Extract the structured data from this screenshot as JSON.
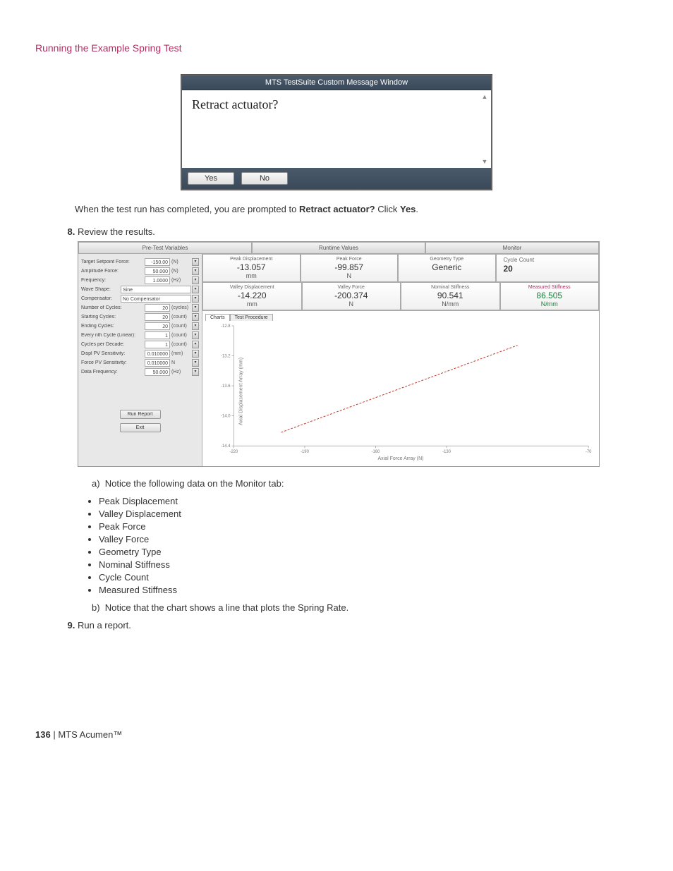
{
  "section_title": "Running the Example Spring Test",
  "dialog": {
    "title": "MTS TestSuite Custom Message Window",
    "message": "Retract actuator?",
    "yes": "Yes",
    "no": "No"
  },
  "intro_line_pre": "When the test run has completed, you are prompted to ",
  "intro_line_bold1": "Retract actuator?",
  "intro_line_mid": " Click ",
  "intro_line_bold2": "Yes",
  "intro_line_end": ".",
  "step8": "Review the results.",
  "results": {
    "tabs": {
      "pre": "Pre-Test Variables",
      "run": "Runtime Values",
      "mon": "Monitor"
    },
    "vars": {
      "target_setpoint": {
        "label": "Target Setpoint Force:",
        "value": "-150.00",
        "unit": "(N)"
      },
      "amplitude": {
        "label": "Amplitude Force:",
        "value": "50.000",
        "unit": "(N)"
      },
      "frequency": {
        "label": "Frequency:",
        "value": "1.0000",
        "unit": "(Hz)"
      },
      "wave_shape": {
        "label": "Wave Shape:",
        "value": "Sine"
      },
      "compensator": {
        "label": "Compensator:",
        "value": "No Compensator"
      },
      "num_cycles": {
        "label": "Number of Cycles:",
        "value": "20",
        "unit": "(cycles)"
      },
      "start_cycles": {
        "label": "Starting Cycles:",
        "value": "20",
        "unit": "(count)"
      },
      "end_cycles": {
        "label": "Ending Cycles:",
        "value": "20",
        "unit": "(count)"
      },
      "every_nth": {
        "label": "Every nth Cycle (Linear):",
        "value": "1",
        "unit": "(count)"
      },
      "cycles_decade": {
        "label": "Cycles per Decade:",
        "value": "1",
        "unit": "(count)"
      },
      "displ_pv": {
        "label": "Displ PV Sensitivity:",
        "value": "0.010000",
        "unit": "(mm)"
      },
      "force_pv": {
        "label": "Force PV Sensitivity:",
        "value": "0.010000",
        "unit": "N"
      },
      "data_freq": {
        "label": "Data Frequency:",
        "value": "50.000",
        "unit": "(Hz)"
      }
    },
    "buttons": {
      "run_report": "Run Report",
      "exit": "Exit"
    },
    "readouts": {
      "peak_disp": {
        "label": "Peak Displacement",
        "value": "-13.057",
        "unit": "mm"
      },
      "peak_force": {
        "label": "Peak Force",
        "value": "-99.857",
        "unit": "N"
      },
      "geom": {
        "label": "Geometry Type",
        "value": "Generic",
        "unit": ""
      },
      "cycle": {
        "label": "Cycle Count",
        "value": "20",
        "unit": ""
      },
      "valley_disp": {
        "label": "Valley Displacement",
        "value": "-14.220",
        "unit": "mm"
      },
      "valley_force": {
        "label": "Valley Force",
        "value": "-200.374",
        "unit": "N"
      },
      "nominal": {
        "label": "Nominal Stiffness",
        "value": "90.541",
        "unit": "N/mm"
      },
      "measured": {
        "label": "Measured Stiffness",
        "value": "86.505",
        "unit": "N/mm"
      }
    },
    "chart_tabs": {
      "charts": "Charts",
      "test": "Test Procedure"
    }
  },
  "chart_data": {
    "type": "line",
    "title": "",
    "xlabel": "Axial Force Array (N)",
    "ylabel": "Axial Displacement Array (mm)",
    "xlim": [
      -220,
      -70
    ],
    "ylim": [
      -14.4,
      -12.8
    ],
    "y_ticks": [
      -12.8,
      -13.2,
      -13.6,
      -14.0,
      -14.4
    ],
    "x_ticks": [
      -220,
      -190,
      -160,
      -130,
      -70
    ],
    "series": [
      {
        "name": "Spring Rate",
        "color": "#c0392b",
        "x": [
          -200,
          -100
        ],
        "y": [
          -14.22,
          -13.06
        ]
      }
    ]
  },
  "step8a": "Notice the following data on the Monitor tab:",
  "bullets": [
    "Peak Displacement",
    "Valley Displacement",
    "Peak Force",
    "Valley Force",
    "Geometry Type",
    "Nominal Stiffness",
    "Cycle Count",
    "Measured Stiffness"
  ],
  "step8b": "Notice that the chart shows a line that plots the Spring Rate.",
  "step9": "Run a report.",
  "footer": {
    "page": "136",
    "sep": " | ",
    "product": "MTS Acumen",
    "tm": "™"
  }
}
